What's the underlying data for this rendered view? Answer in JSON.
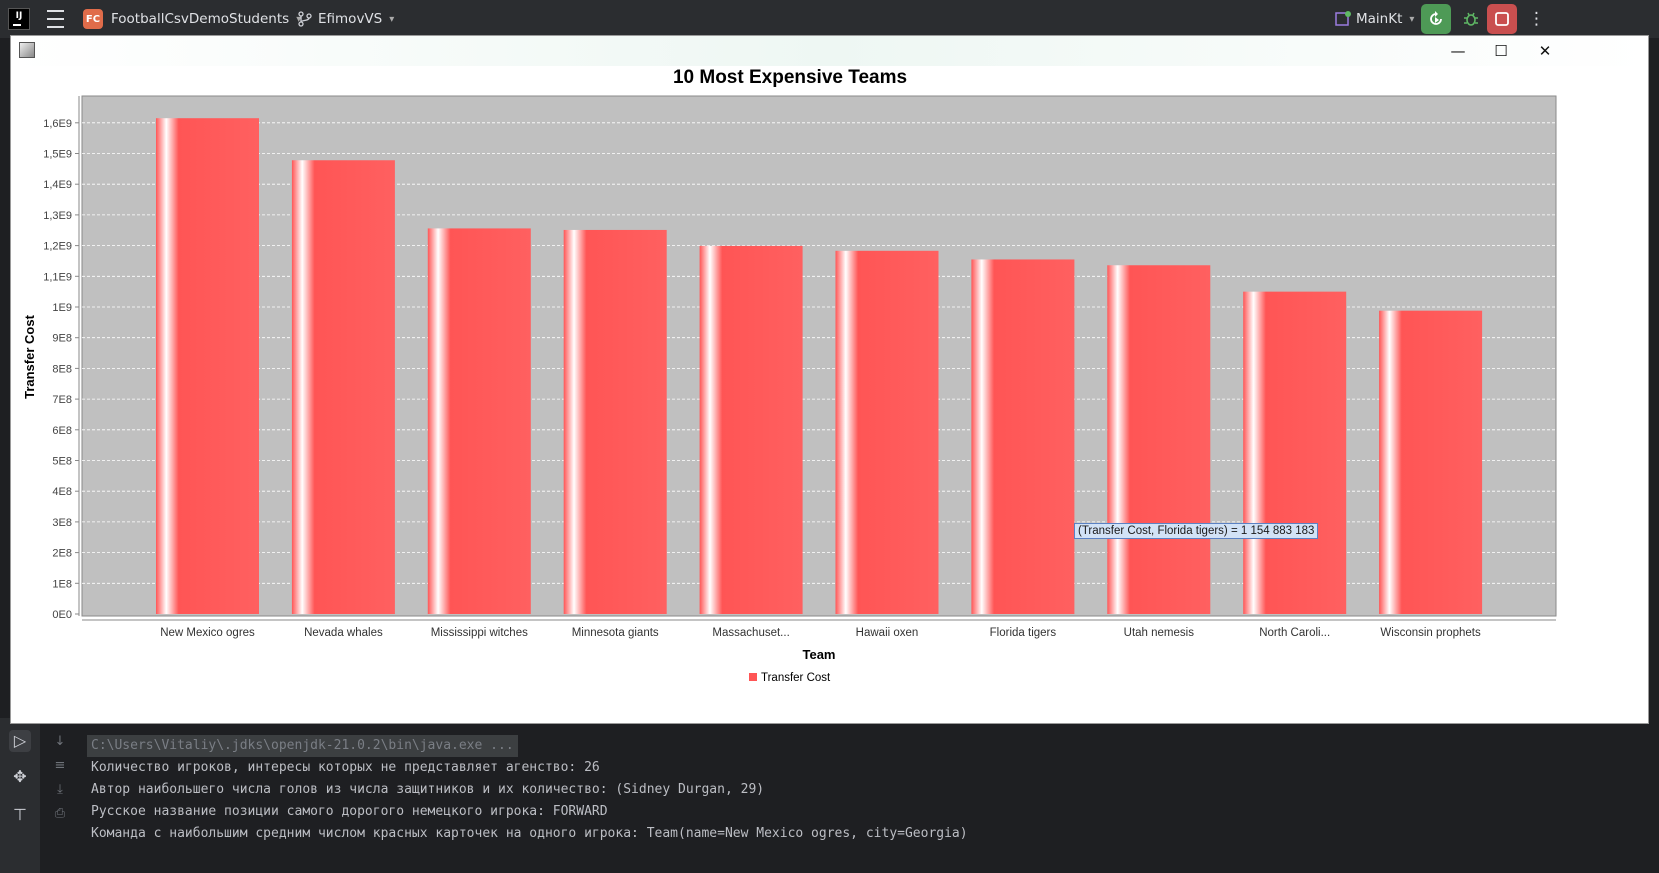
{
  "ide": {
    "logo_text": "IJ",
    "project_badge": "FC",
    "project_name": "FootballCsvDemoStudents",
    "branch": "EfimovVS",
    "run_config": "MainKt"
  },
  "window": {
    "minimize_label": "—",
    "maximize_label": "☐",
    "close_label": "✕"
  },
  "chart_data": {
    "type": "bar",
    "title": "10 Most Expensive Teams",
    "xlabel": "Team",
    "ylabel": "Transfer Cost",
    "categories": [
      "New Mexico ogres",
      "Nevada whales",
      "Mississippi witches",
      "Minnesota giants",
      "Massachuset...",
      "Hawaii oxen",
      "Florida tigers",
      "Utah nemesis",
      "North Caroli...",
      "Wisconsin prophets"
    ],
    "series": [
      {
        "name": "Transfer Cost",
        "values": [
          1615000000,
          1478000000,
          1256000000,
          1251000000,
          1199000000,
          1183000000,
          1154883183,
          1136000000,
          1050000000,
          988000000
        ]
      }
    ],
    "ylim": [
      0,
      1700000000
    ],
    "yticks": [
      0,
      100000000,
      200000000,
      300000000,
      400000000,
      500000000,
      600000000,
      700000000,
      800000000,
      900000000,
      1000000000,
      1100000000,
      1200000000,
      1300000000,
      1400000000,
      1500000000,
      1600000000
    ],
    "ytick_labels": [
      "0E0",
      "1E8",
      "2E8",
      "3E8",
      "4E8",
      "5E8",
      "6E8",
      "7E8",
      "8E8",
      "9E8",
      "1E9",
      "1,1E9",
      "1,2E9",
      "1,3E9",
      "1,4E9",
      "1,5E9",
      "1,6E9"
    ],
    "grid": true,
    "legend": "bottom",
    "bar_color": "#ff5555",
    "plot_bg": "#c0c0c0",
    "tooltip": "(Transfer Cost, Florida tigers) = 1 154 883 183"
  },
  "console": {
    "command": "C:\\Users\\Vitaliy\\.jdks\\openjdk-21.0.2\\bin\\java.exe ...",
    "lines": [
      "Количество игроков, интересы которых не представляет агенство: 26",
      "Автор наибольшего числа голов из числа защитников и их количество: (Sidney Durgan, 29)",
      "Русское название позиции самого дорогого немецкого игрока: FORWARD",
      "Команда с наибольшим средним числом красных карточек на одного игрока: Team(name=New Mexico ogres, city=Georgia)"
    ]
  }
}
